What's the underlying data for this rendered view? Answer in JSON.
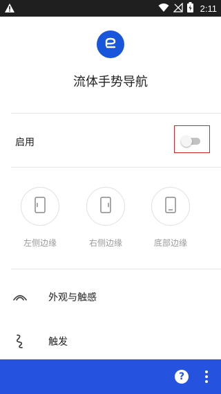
{
  "status_bar": {
    "time": "2:11",
    "icons": [
      "warning-icon",
      "wifi-icon",
      "signal-off-icon",
      "battery-charging-icon"
    ]
  },
  "app": {
    "title": "流体手势导航",
    "logo_icon": "fluid-navigation-logo-icon"
  },
  "enable": {
    "label": "启用",
    "toggle_on": false
  },
  "edges": [
    {
      "label": "左侧边缘",
      "icon": "left-edge-phone-icon"
    },
    {
      "label": "右侧边缘",
      "icon": "right-edge-phone-icon"
    },
    {
      "label": "底部边缘",
      "icon": "bottom-edge-phone-icon"
    }
  ],
  "menu": [
    {
      "label": "外观与触感",
      "icon": "appearance-arc-icon"
    },
    {
      "label": "触发",
      "icon": "trigger-squiggle-icon"
    }
  ],
  "bottom_bar": {
    "help_label": "?",
    "accent_color": "#2652e0"
  },
  "colors": {
    "accent": "#1a56db",
    "highlight": "#e02020"
  }
}
